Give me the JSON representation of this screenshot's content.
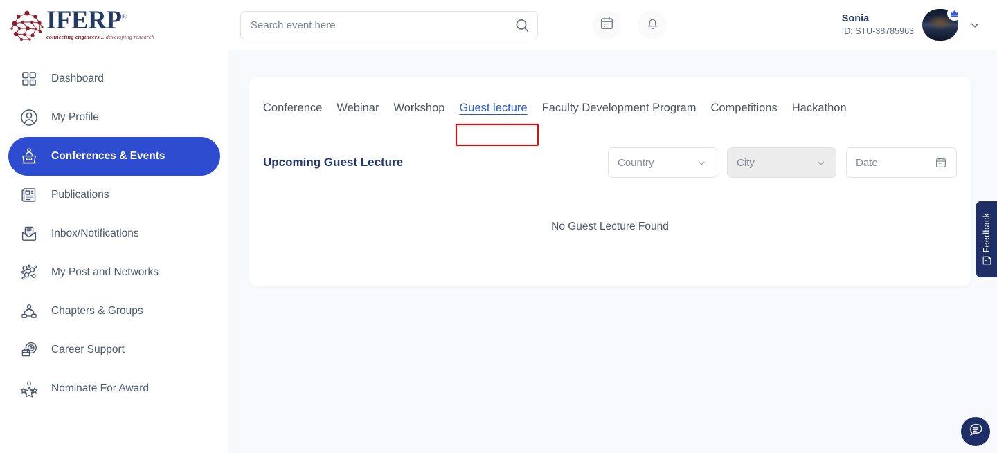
{
  "brand": {
    "name": "IFERP",
    "registered_mark": "®",
    "tagline_part1": "connecting engineers...",
    "tagline_part2": "developing research"
  },
  "colors": {
    "accent_blue": "#2e4ccf",
    "active_tab_blue": "#2a5bd7",
    "navy": "#24376a",
    "highlight_red": "#ff0000",
    "feedback_navy": "#1d2f66",
    "page_bg": "#f7f9fd",
    "card_bg": "#ffffff"
  },
  "sidebar": {
    "items": [
      {
        "label": "Dashboard",
        "icon": "grid-icon",
        "active": false
      },
      {
        "label": "My Profile",
        "icon": "user-circle-icon",
        "active": false
      },
      {
        "label": "Conferences & Events",
        "icon": "podium-icon",
        "active": true
      },
      {
        "label": "Publications",
        "icon": "newspaper-icon",
        "active": false
      },
      {
        "label": "Inbox/Notifications",
        "icon": "envelope-icon",
        "active": false
      },
      {
        "label": "My Post and Networks",
        "icon": "network-icon",
        "active": false
      },
      {
        "label": "Chapters & Groups",
        "icon": "group-icon",
        "active": false
      },
      {
        "label": "Career Support",
        "icon": "briefcase-target-icon",
        "active": false
      },
      {
        "label": "Nominate For Award",
        "icon": "award-stars-icon",
        "active": false
      }
    ]
  },
  "header": {
    "search": {
      "placeholder": "Search event here",
      "value": "",
      "icon": "search-icon"
    },
    "calendar_button_icon": "calendar-icon",
    "notification_button_icon": "bell-icon",
    "user": {
      "name": "Sonia",
      "id": "ID: STU-38785963",
      "avatar_icon": "user-avatar",
      "badge_icon": "crown-icon",
      "dropdown_icon": "chevron-down-icon"
    }
  },
  "main": {
    "tabs": [
      {
        "label": "Conference",
        "active": false
      },
      {
        "label": "Webinar",
        "active": false
      },
      {
        "label": "Workshop",
        "active": false
      },
      {
        "label": "Guest lecture",
        "active": true
      },
      {
        "label": "Faculty Development Program",
        "active": false
      },
      {
        "label": "Competitions",
        "active": false
      },
      {
        "label": "Hackathon",
        "active": false
      }
    ],
    "section_title": "Upcoming Guest Lecture",
    "filters": [
      {
        "label": "Country",
        "icon": "chevron-down-icon",
        "disabled": false
      },
      {
        "label": "City",
        "icon": "chevron-down-icon",
        "disabled": true
      },
      {
        "label": "Date",
        "icon": "calendar-icon",
        "disabled": false
      }
    ],
    "empty_state_text": "No Guest Lecture Found"
  },
  "feedback": {
    "label": "Feedback",
    "icon": "feedback-note-icon"
  },
  "chat": {
    "icon": "chat-bubble-icon"
  }
}
